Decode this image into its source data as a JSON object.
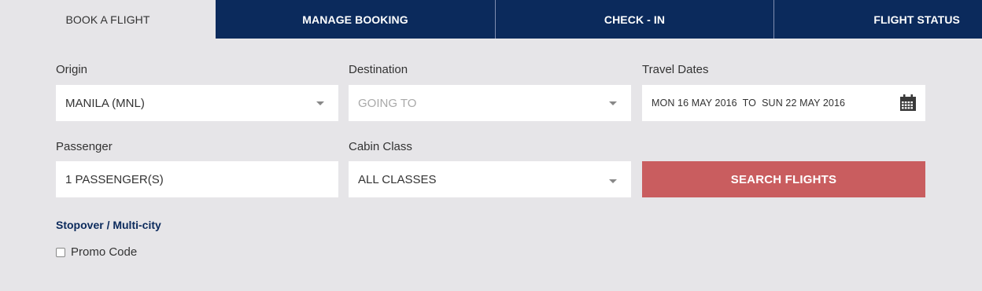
{
  "tabs": [
    {
      "label": "BOOK A FLIGHT",
      "active": true
    },
    {
      "label": "MANAGE BOOKING",
      "active": false
    },
    {
      "label": "CHECK - IN",
      "active": false
    },
    {
      "label": "FLIGHT STATUS",
      "active": false
    }
  ],
  "form": {
    "origin": {
      "label": "Origin",
      "value": "MANILA (MNL)"
    },
    "destination": {
      "label": "Destination",
      "placeholder": "GOING TO"
    },
    "travel_dates": {
      "label": "Travel Dates",
      "value": "MON 16 MAY 2016  TO  SUN 22 MAY 2016",
      "icon": "calendar-icon"
    },
    "passenger": {
      "label": "Passenger",
      "value": "1 PASSENGER(S)"
    },
    "cabin_class": {
      "label": "Cabin Class",
      "value": "ALL CLASSES"
    },
    "search_button": {
      "label": "SEARCH FLIGHTS"
    },
    "stopover_link": "Stopover / Multi-city",
    "promo_code": {
      "label": "Promo Code",
      "checked": false
    }
  },
  "colors": {
    "nav_background": "#0b2a5c",
    "page_background": "#e6e5e8",
    "search_button": "#c95d5f",
    "link": "#0b2a5c"
  }
}
